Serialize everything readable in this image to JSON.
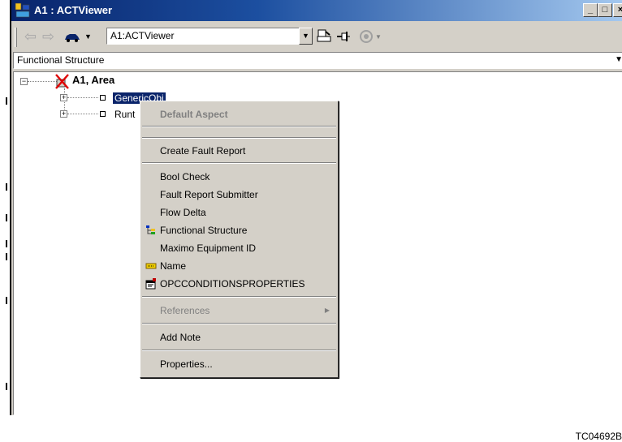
{
  "window": {
    "title": "A1 : ACTViewer",
    "controls": {
      "minimize": "_",
      "maximize": "□",
      "close": "×"
    }
  },
  "toolbar": {
    "back_icon": "arrow-left-icon",
    "forward_icon": "arrow-right-icon",
    "address_value": "A1:ACTViewer"
  },
  "structure_selector": {
    "value": "Functional Structure"
  },
  "tree": {
    "root": {
      "label": "A1, Area",
      "expander": "−"
    },
    "children": [
      {
        "label": "GenericObj",
        "expander": "+"
      },
      {
        "label": "Runt",
        "expander": "+"
      }
    ]
  },
  "context_menu": {
    "header": "Default Aspect",
    "items": [
      {
        "label": "Create Fault Report"
      },
      {
        "label": "Bool Check"
      },
      {
        "label": "Fault Report Submitter"
      },
      {
        "label": "Flow Delta"
      },
      {
        "label": "Functional Structure",
        "icon": "structure-tree-icon"
      },
      {
        "label": "Maximo Equipment ID"
      },
      {
        "label": "Name",
        "icon": "name-tag-icon"
      },
      {
        "label": "OPCCONDITIONSPROPERTIES",
        "icon": "properties-icon"
      },
      {
        "label": "References",
        "disabled": true,
        "submenu": true
      },
      {
        "label": "Add Note"
      },
      {
        "label": "Properties..."
      }
    ]
  },
  "figure_code": "TC04692B",
  "colors": {
    "title_start": "#08246b",
    "title_end": "#a6caf0",
    "selection": "#0a246a",
    "face": "#d4d0c8"
  }
}
